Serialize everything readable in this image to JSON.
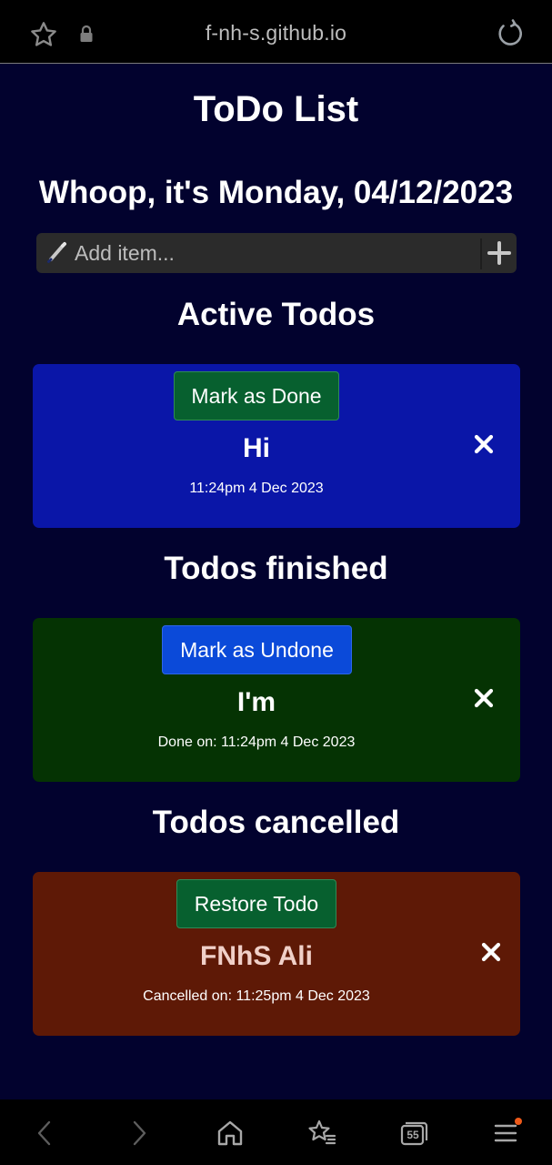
{
  "browser": {
    "url": "f-nh-s.github.io",
    "tab_count": "55"
  },
  "page": {
    "title": "ToDo List",
    "date_line": "Whoop, it's Monday, 04/12/2023"
  },
  "add_item": {
    "placeholder": "Add item..."
  },
  "active": {
    "heading": "Active Todos",
    "button_label": "Mark as Done",
    "text": "Hi",
    "time": "11:24pm 4 Dec 2023",
    "color": "#0a16a8"
  },
  "finished": {
    "heading": "Todos finished",
    "button_label": "Mark as Undone",
    "text": "I'm",
    "time": "Done on: 11:24pm 4 Dec 2023",
    "color": "#053303"
  },
  "cancelled": {
    "heading": "Todos cancelled",
    "button_label": "Restore Todo",
    "text": "FNhS Ali",
    "time": "Cancelled on: 11:25pm 4 Dec 2023",
    "color": "#5e1906"
  },
  "colors": {
    "background": "#02022e",
    "green_button": "#07602f",
    "blue_button": "#0b4ad9"
  },
  "icons": [
    "star-icon",
    "lock-icon",
    "reload-icon",
    "pencil-icon",
    "plus-icon",
    "close-icon",
    "back-icon",
    "forward-icon",
    "home-icon",
    "bookmarks-icon",
    "tabs-icon",
    "menu-icon"
  ]
}
